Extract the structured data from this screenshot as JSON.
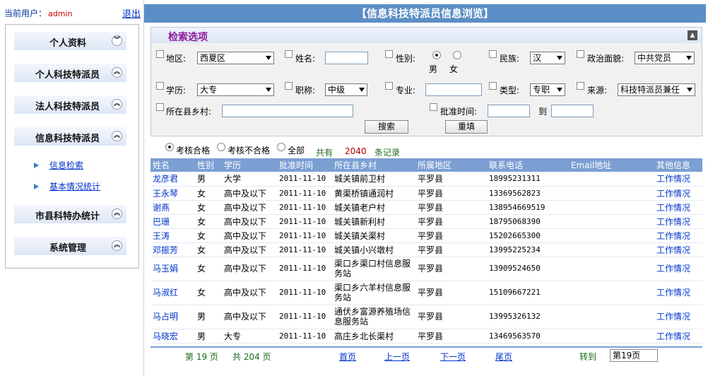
{
  "user": {
    "label": "当前用户：",
    "name": "admin",
    "logout": "退出"
  },
  "menu": {
    "items": [
      {
        "label": "个人资料",
        "chevron": "︾"
      },
      {
        "label": "个人科技特派员",
        "chevron": "︽"
      },
      {
        "label": "法人科技特派员",
        "chevron": "︽"
      },
      {
        "label": "信息科技特派员",
        "chevron": "︽"
      },
      {
        "label": "市县科特办统计",
        "chevron": "︽"
      },
      {
        "label": "系统管理",
        "chevron": "︽"
      }
    ],
    "subitems": [
      "信息检索",
      "基本情况统计"
    ]
  },
  "page_title": "【信息科技特派员信息浏览】",
  "search": {
    "title": "检索选项",
    "collapse_icon": "collapse-icon",
    "region": {
      "label": "地区:",
      "value": "西夏区"
    },
    "name": {
      "label": "姓名:",
      "value": ""
    },
    "gender": {
      "label": "性别:",
      "options": [
        "男",
        "女"
      ],
      "selected": "男"
    },
    "ethnicity": {
      "label": "民族:",
      "value": "汉"
    },
    "political": {
      "label": "政治面貌:",
      "value": "中共党员"
    },
    "education": {
      "label": "学历:",
      "value": "大专"
    },
    "title_rank": {
      "label": "职称:",
      "value": "中级"
    },
    "major": {
      "label": "专业:",
      "value": ""
    },
    "type": {
      "label": "类型:",
      "value": "专职"
    },
    "source": {
      "label": "来源:",
      "value": "科技特派员兼任"
    },
    "village": {
      "label": "所在县乡村:",
      "value": ""
    },
    "approve_time": {
      "label": "批准时间:",
      "to_label": "到",
      "from": "",
      "to": ""
    },
    "search_button": "搜索",
    "reset_button": "重填"
  },
  "filters": {
    "options": [
      "考核合格",
      "考核不合格",
      "全部"
    ],
    "selected": "考核合格",
    "total_prefix": "共有",
    "total_count": "2040",
    "total_suffix": "条记录"
  },
  "table": {
    "columns": [
      "姓名",
      "性别",
      "学历",
      "批准时间",
      "所在县乡村",
      "所属地区",
      "联系电话",
      "Email地址",
      "其他信息"
    ],
    "rows": [
      {
        "name": "龙彦君",
        "gender": "男",
        "edu": "大学",
        "date": "2011-11-10",
        "village": "城关镇前卫村",
        "area": "平罗县",
        "phone": "18995231311",
        "email": "",
        "other": "工作情况"
      },
      {
        "name": "王永琴",
        "gender": "女",
        "edu": "高中及以下",
        "date": "2011-11-10",
        "village": "黄渠桥镇通润村",
        "area": "平罗县",
        "phone": "13369562823",
        "email": "",
        "other": "工作情况"
      },
      {
        "name": "谢燕",
        "gender": "女",
        "edu": "高中及以下",
        "date": "2011-11-10",
        "village": "城关镇老户村",
        "area": "平罗县",
        "phone": "138954669519",
        "email": "",
        "other": "工作情况"
      },
      {
        "name": "巴珊",
        "gender": "女",
        "edu": "高中及以下",
        "date": "2011-11-10",
        "village": "城关镇新利村",
        "area": "平罗县",
        "phone": "18795068390",
        "email": "",
        "other": "工作情况"
      },
      {
        "name": "王涛",
        "gender": "女",
        "edu": "高中及以下",
        "date": "2011-11-10",
        "village": "城关镇关渠村",
        "area": "平罗县",
        "phone": "15202665300",
        "email": "",
        "other": "工作情况"
      },
      {
        "name": "邓振芳",
        "gender": "女",
        "edu": "高中及以下",
        "date": "2011-11-10",
        "village": "城关镇小兴墩村",
        "area": "平罗县",
        "phone": "13995225234",
        "email": "",
        "other": "工作情况"
      },
      {
        "name": "马玉娟",
        "gender": "女",
        "edu": "高中及以下",
        "date": "2011-11-10",
        "village": "渠口乡渠口村信息服务站",
        "area": "平罗县",
        "phone": "13909524650",
        "email": "",
        "other": "工作情况"
      },
      {
        "name": "马淑红",
        "gender": "女",
        "edu": "高中及以下",
        "date": "2011-11-10",
        "village": "渠口乡六羊村信息服务站",
        "area": "平罗县",
        "phone": "15109667221",
        "email": "",
        "other": "工作情况"
      },
      {
        "name": "马占明",
        "gender": "男",
        "edu": "高中及以下",
        "date": "2011-11-10",
        "village": "通伏乡富源养殖场信息服务站",
        "area": "平罗县",
        "phone": "13995326132",
        "email": "",
        "other": "工作情况"
      },
      {
        "name": "马晓宏",
        "gender": "男",
        "edu": "大专",
        "date": "2011-11-10",
        "village": "高庄乡北长渠村",
        "area": "平罗县",
        "phone": "13469563570",
        "email": "",
        "other": "工作情况"
      }
    ]
  },
  "pager": {
    "current": "第 19 页",
    "total": "共 204 页",
    "first": "首页",
    "prev": "上一页",
    "next": "下一页",
    "last": "尾页",
    "goto_label": "转到",
    "goto_value": "第19页"
  }
}
